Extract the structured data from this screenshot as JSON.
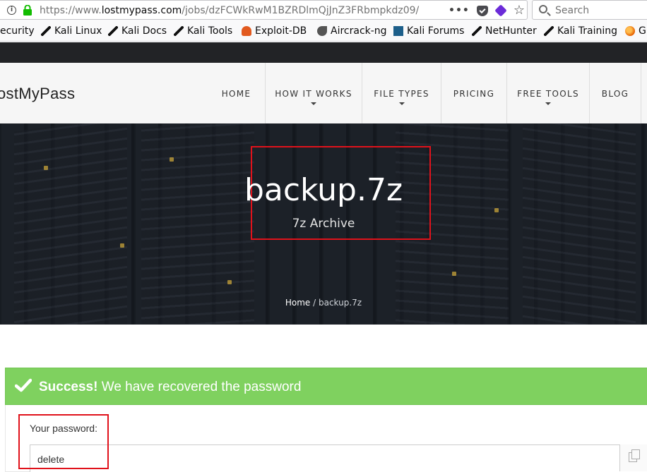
{
  "browser": {
    "url_prefix": "https://www.",
    "url_host": "lostmypass.com",
    "url_path": "/jobs/dzFCWkRwM1BZRDlmQjJnZ3FRbmpkdz09/",
    "search_placeholder": "Search",
    "bookmarks": [
      "ecurity",
      "Kali Linux",
      "Kali Docs",
      "Kali Tools",
      "Exploit-DB",
      "Aircrack-ng",
      "Kali Forums",
      "NetHunter",
      "Kali Training",
      "G"
    ]
  },
  "site": {
    "logo": "ostMyPass",
    "nav": [
      "HOME",
      "HOW IT WORKS",
      "FILE TYPES",
      "PRICING",
      "FREE TOOLS",
      "BLOG"
    ]
  },
  "hero": {
    "title": "backup.7z",
    "subtitle": "7z Archive",
    "breadcrumb_home": "Home",
    "breadcrumb_sep": " / ",
    "breadcrumb_current": "backup.7z"
  },
  "result": {
    "success_strong": "Success!",
    "success_text": " We have recovered the password",
    "password_label": "Your password:",
    "password_value": "delete"
  },
  "colors": {
    "success_green": "#7fd15f",
    "highlight_red": "#e0121b",
    "dark_strip": "#222326"
  }
}
